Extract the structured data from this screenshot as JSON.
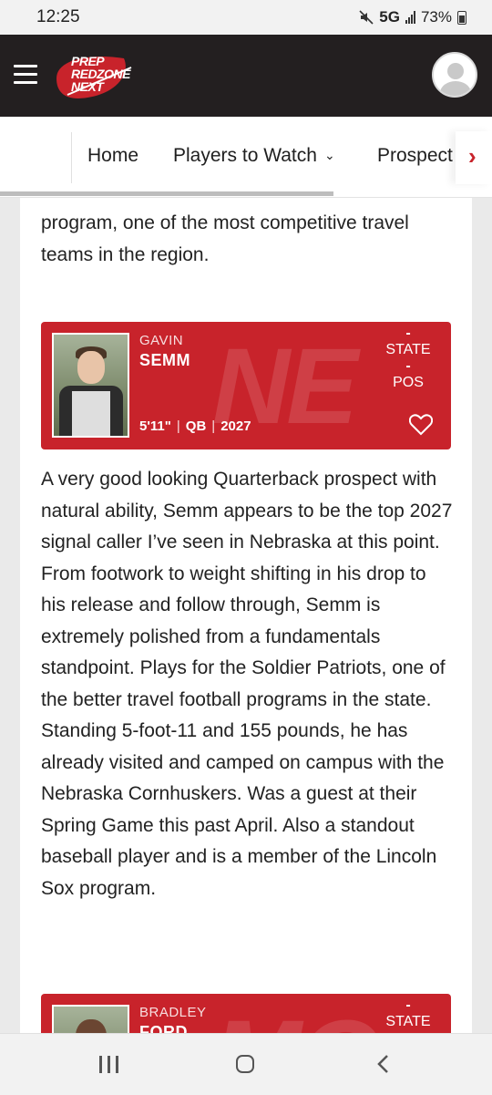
{
  "status_bar": {
    "time": "12:25",
    "network": "5G",
    "battery": "73%",
    "icons": [
      "mute-icon",
      "signal-icon",
      "battery-icon"
    ]
  },
  "header": {
    "logo_lines": [
      "PREP",
      "REDZONE",
      "NEXT"
    ],
    "logo_accent": "#c8232b",
    "background": "#231f20"
  },
  "nav": {
    "items": [
      {
        "label": "Home"
      },
      {
        "label": "Players to Watch"
      },
      {
        "label": "Prospect"
      }
    ],
    "players_chevron": "⌄",
    "next_arrow": "›"
  },
  "content": {
    "intro_text": "program, one of the most competitive travel teams in the region.",
    "players": [
      {
        "first_name": "GAVIN",
        "last_name": "SEMM",
        "height": "5'11\"",
        "position": "QB",
        "class_year": "2027",
        "state_value": "-",
        "state_label": "STATE",
        "pos_value": "-",
        "pos_label": "POS",
        "state_watermark": "NE"
      },
      {
        "first_name": "BRADLEY",
        "last_name": "FORD",
        "state_value": "-",
        "state_label": "STATE",
        "state_watermark": "MO"
      }
    ],
    "semm_writeup": "A very good looking Quarterback prospect with natural ability, Semm appears to be the top 2027 signal caller I’ve seen in Nebraska at this point. From footwork to weight shifting in his drop to his release and follow through, Semm is extremely polished from a fundamentals standpoint. Plays for the Soldier Patriots, one of the better travel football programs in the state. Standing 5-foot-11 and 155 pounds, he has already visited and camped on campus with the Nebraska Cornhuskers. Was a guest at their Spring Game this past April. Also a standout baseball player and is a member of the Lincoln Sox program."
  },
  "colors": {
    "card_red": "#c8232b",
    "header_dark": "#231f20"
  }
}
